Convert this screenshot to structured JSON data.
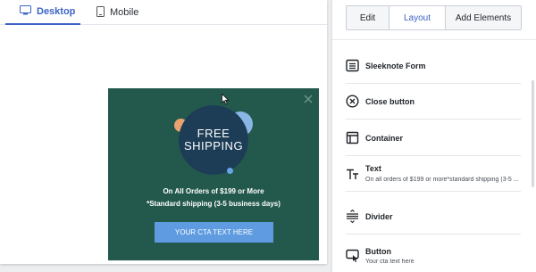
{
  "device_tabs": [
    {
      "label": "Desktop",
      "icon": "desktop-icon",
      "active": true
    },
    {
      "label": "Mobile",
      "icon": "mobile-icon",
      "active": false
    }
  ],
  "popup": {
    "badge_line1": "FREE",
    "badge_line2": "SHIPPING",
    "line1": "On All Orders of $199 or More",
    "line2": "*Standard shipping (3-5 business days)",
    "cta": "YOUR CTA TEXT HERE",
    "background": "#23594c",
    "cta_color": "#5f9be0"
  },
  "panel": {
    "tabs": [
      {
        "label": "Edit",
        "active": false
      },
      {
        "label": "Layout",
        "active": true
      },
      {
        "label": "Add Elements",
        "active": false
      }
    ],
    "elements": [
      {
        "name": "Sleeknote Form",
        "icon": "form-icon",
        "sub": ""
      },
      {
        "name": "Close button",
        "icon": "close-circle-icon",
        "sub": ""
      },
      {
        "name": "Container",
        "icon": "container-icon",
        "sub": ""
      },
      {
        "name": "Text",
        "icon": "text-icon",
        "sub": "On all orders of $199 or more*standard shipping (3-5 ..."
      },
      {
        "name": "Divider",
        "icon": "divider-icon",
        "sub": ""
      },
      {
        "name": "Button",
        "icon": "button-icon",
        "sub": "Your cta text here"
      }
    ]
  },
  "accent": "#3b63c4"
}
